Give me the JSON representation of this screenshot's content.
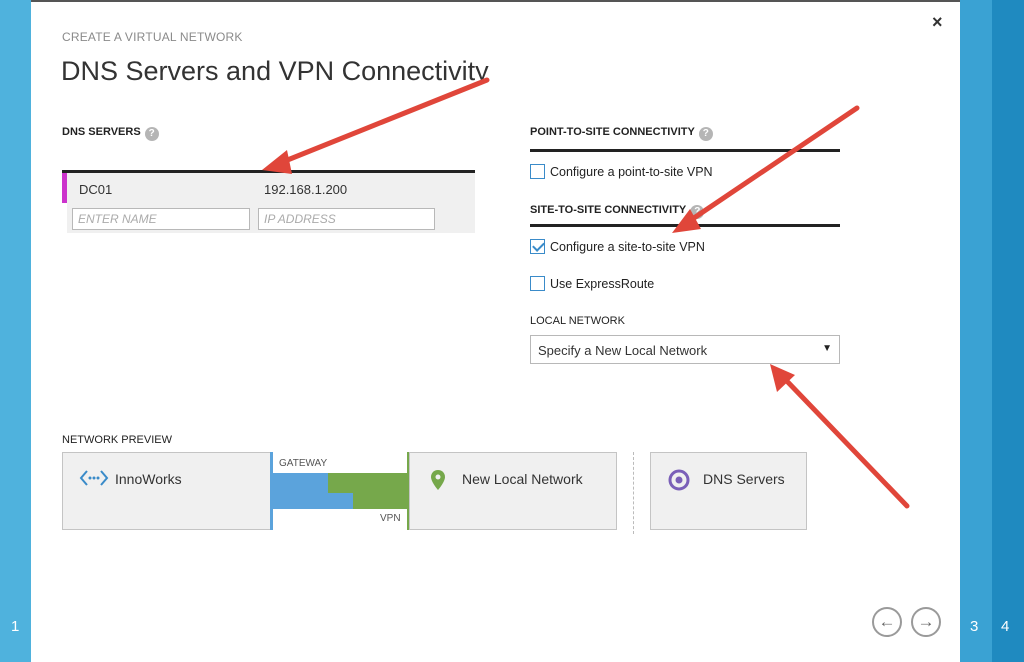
{
  "wizard": {
    "subtitle": "CREATE A VIRTUAL NETWORK",
    "title": "DNS Servers and VPN Connectivity",
    "close_symbol": "×",
    "steps": {
      "left": "1",
      "right_a": "3",
      "right_b": "4"
    }
  },
  "dns": {
    "section_label": "DNS SERVERS",
    "help": "?",
    "rows": [
      {
        "name": "DC01",
        "ip": "192.168.1.200"
      }
    ],
    "name_placeholder": "ENTER NAME",
    "ip_placeholder": "IP ADDRESS"
  },
  "point_to_site": {
    "section_label": "POINT-TO-SITE CONNECTIVITY",
    "help": "?",
    "checkbox_label": "Configure a point-to-site VPN",
    "checked": false
  },
  "site_to_site": {
    "section_label": "SITE-TO-SITE CONNECTIVITY",
    "help": "?",
    "checkbox_label": "Configure a site-to-site VPN",
    "checked": true,
    "expressroute_label": "Use ExpressRoute",
    "expressroute_checked": false
  },
  "local_network": {
    "label": "LOCAL NETWORK",
    "selected": "Specify a New Local Network",
    "caret": "▼"
  },
  "preview": {
    "label": "NETWORK PREVIEW",
    "virtual_network": "InnoWorks",
    "gateway_label": "GATEWAY",
    "vpn_label": "VPN",
    "local_network": "New Local Network",
    "dns_servers": "DNS Servers"
  },
  "nav": {
    "back": "←",
    "next": "→"
  },
  "colors": {
    "accent_blue": "#3a8bc9",
    "dns_row_marker": "#cc33cc",
    "gateway_blue": "#5ba3dc",
    "vpn_green": "#76a84b",
    "annotation_red": "#e0463a",
    "dns_icon_purple": "#7a5fb8"
  },
  "icons": {
    "virtual_network": "network-brackets-icon",
    "local_network": "map-pin-icon",
    "dns": "dns-circle-icon"
  }
}
